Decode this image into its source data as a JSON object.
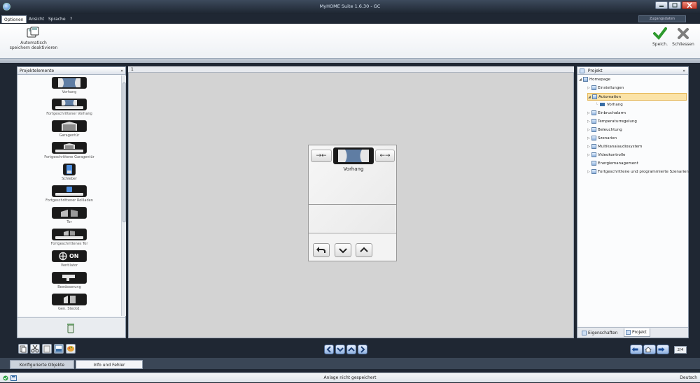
{
  "window": {
    "title": "MyHOME Suite 1.6.30 - GC"
  },
  "menu": {
    "items": [
      "Optionen",
      "Ansicht",
      "Sprache",
      "?"
    ],
    "active": "Optionen"
  },
  "access": {
    "label": "Zugangsdaten"
  },
  "ribbon": {
    "autosave_line1": "Automatisch",
    "autosave_line2": "speichern deaktivieren",
    "save_label": "Speich.",
    "close_label": "Schliessen"
  },
  "elements_panel": {
    "title": "Projektelemente",
    "pin": "»",
    "items": [
      {
        "label": "Vorhang",
        "icon": "curtain-icon"
      },
      {
        "label": "Fortgeschrittener Vorhang",
        "icon": "advanced-curtain-icon"
      },
      {
        "label": "Garagentür",
        "icon": "garage-door-icon"
      },
      {
        "label": "Fortgeschrittene Garagentür",
        "icon": "advanced-garage-door-icon"
      },
      {
        "label": "Schieber",
        "icon": "slider-icon"
      },
      {
        "label": "Fortgeschrittener Rollladen",
        "icon": "advanced-shutter-icon"
      },
      {
        "label": "Tor",
        "icon": "gate-icon"
      },
      {
        "label": "Fortgeschrittenes Tor",
        "icon": "advanced-gate-icon"
      },
      {
        "label": "Ventilator",
        "icon": "fan-icon",
        "badge": "ON"
      },
      {
        "label": "Bewässerung",
        "icon": "irrigation-icon"
      },
      {
        "label": "Gen. Steckd.",
        "icon": "socket-icon"
      }
    ]
  },
  "canvas": {
    "page_number": "1"
  },
  "device": {
    "title": "Vorhang",
    "close_symbol": "→←",
    "open_symbol": "←→"
  },
  "project_panel": {
    "title": "Projekt",
    "pin": "»",
    "tree": [
      {
        "label": "Homepage",
        "level": 0,
        "arrow": "◢"
      },
      {
        "label": "Einstellungen",
        "level": 1,
        "arrow": "▷"
      },
      {
        "label": "Automation",
        "level": 1,
        "arrow": "◢",
        "selected": true
      },
      {
        "label": "Vorhang",
        "level": 2,
        "arrow": ""
      },
      {
        "label": "Einbruchalarm",
        "level": 1,
        "arrow": "▷"
      },
      {
        "label": "Temperaturregelung",
        "level": 1,
        "arrow": "▷"
      },
      {
        "label": "Beleuchtung",
        "level": 1,
        "arrow": "▷"
      },
      {
        "label": "Szenarien",
        "level": 1,
        "arrow": "▷"
      },
      {
        "label": "Multikanalaudiosystem",
        "level": 1,
        "arrow": "▷"
      },
      {
        "label": "Videokontrolle",
        "level": 1,
        "arrow": "▷"
      },
      {
        "label": "Energiemanagement",
        "level": 1,
        "arrow": ""
      },
      {
        "label": "Fortgeschrittene und programmierte Szenarien",
        "level": 1,
        "arrow": "▷"
      }
    ],
    "tabs": [
      "Eigenschaften",
      "Projekt"
    ]
  },
  "pager": {
    "label": "2/4"
  },
  "bottom_tabs": [
    "Konfigurierte Objekte",
    "Info und Fehler"
  ],
  "status": {
    "message": "Anlage nicht gespeichert",
    "language": "Deutsch"
  },
  "colors": {
    "accent": "#3a7fd0",
    "selection": "#fbe3a7",
    "dark": "#1f2733"
  }
}
